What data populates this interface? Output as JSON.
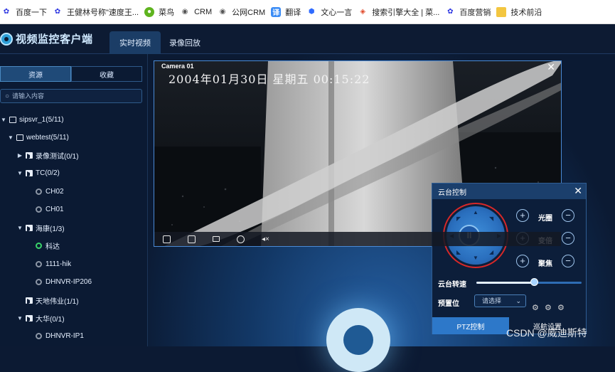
{
  "browser": {
    "bookmarks": [
      {
        "label": "百度一下",
        "icon": "baidu-paw-icon",
        "color": "#2932e1"
      },
      {
        "label": "王健林号称\"速度王...",
        "icon": "baidu-paw-icon",
        "color": "#2932e1"
      },
      {
        "label": "菜鸟",
        "icon": "runoob-icon",
        "color": "#5fb41f"
      },
      {
        "label": "CRM",
        "icon": "globe-icon",
        "color": "#555555"
      },
      {
        "label": "公网CRM",
        "icon": "globe-icon",
        "color": "#555555"
      },
      {
        "label": "翻译",
        "icon": "translate-icon",
        "color": "#3b8cf5"
      },
      {
        "label": "文心一言",
        "icon": "wenxin-icon",
        "color": "#2f6bff"
      },
      {
        "label": "搜索引擎大全 | 菜...",
        "icon": "cube-icon",
        "color": "#e04a2b"
      },
      {
        "label": "百度营销",
        "icon": "baidu-paw-icon",
        "color": "#2932e1"
      },
      {
        "label": "技术前沿",
        "icon": "folder-icon",
        "color": "#f3c640"
      }
    ]
  },
  "app": {
    "title": "视频监控客户端",
    "tabs": [
      {
        "label": "实时视频",
        "active": true
      },
      {
        "label": "录像回放",
        "active": false
      }
    ]
  },
  "sidebar": {
    "tabs": [
      {
        "label": "资源",
        "active": true
      },
      {
        "label": "收藏",
        "active": false
      }
    ],
    "search_placeholder": "请输入内容",
    "tree": [
      {
        "label": "sipsvr_1(5/11)",
        "type": "root",
        "expanded": true
      },
      {
        "label": "webtest(5/11)",
        "type": "server",
        "expanded": true
      },
      {
        "label": "录像测试(0/1)",
        "type": "folder",
        "expanded": false
      },
      {
        "label": "TC(0/2)",
        "type": "folder",
        "expanded": true
      },
      {
        "label": "CH02",
        "type": "camera",
        "online": false
      },
      {
        "label": "CH01",
        "type": "camera",
        "online": false
      },
      {
        "label": "海康(1/3)",
        "type": "folder",
        "expanded": true
      },
      {
        "label": "科达",
        "type": "camera",
        "online": true
      },
      {
        "label": "1111-hik",
        "type": "camera",
        "online": false
      },
      {
        "label": "DHNVR-IP206",
        "type": "camera",
        "online": false
      },
      {
        "label": "天地伟业(1/1)",
        "type": "folder",
        "expanded": false
      },
      {
        "label": "大华(0/1)",
        "type": "folder",
        "expanded": true
      },
      {
        "label": "DHNVR-IP1",
        "type": "camera",
        "online": false
      }
    ]
  },
  "video": {
    "title": "Camera 01",
    "osd": "2004年01月30日  星期五  00:15:22",
    "toolbar_icons": [
      "fullscreen-icon",
      "copy-icon",
      "record-icon",
      "ptz-icon",
      "mute-icon"
    ]
  },
  "ptz": {
    "title": "云台控制",
    "controls": [
      {
        "label": "光圈"
      },
      {
        "label": "变倍"
      },
      {
        "label": "聚焦"
      }
    ],
    "speed_label": "云台转速",
    "speed_value": 0.55,
    "preset_label": "预置位",
    "preset_placeholder": "请选择",
    "footer_tabs": [
      {
        "label": "PTZ控制",
        "active": true
      },
      {
        "label": "巡航设置",
        "active": false
      }
    ]
  },
  "watermark": "CSDN @威迪斯特"
}
